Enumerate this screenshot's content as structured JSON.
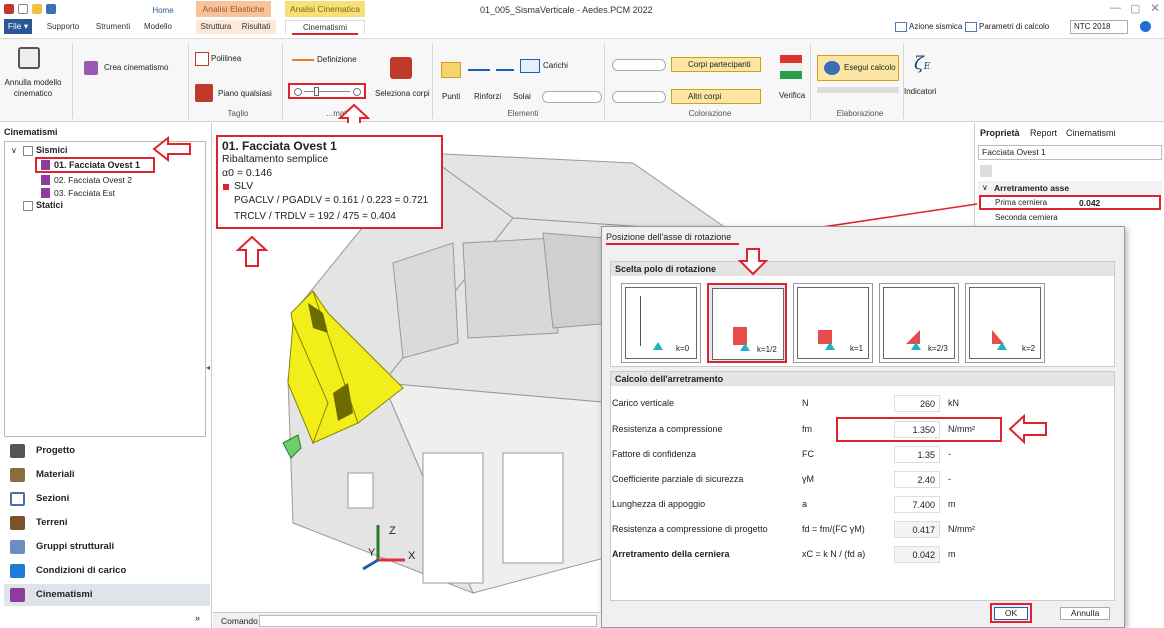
{
  "app": {
    "title": "01_005_SismaVerticale - Aedes.PCM 2022"
  },
  "menu": {
    "file": "File ▾",
    "items": [
      "Supporto",
      "Strumenti",
      "Modello",
      "Struttura",
      "Risultati"
    ],
    "home": "Home"
  },
  "context_tabs": {
    "elastiche": "Analisi Elastiche",
    "cinematica": "Analisi Cinematica",
    "cinematismi": "Cinematismi"
  },
  "top_right": {
    "azione": "Azione sismica",
    "parametri": "Parametri di calcolo",
    "ntc": "NTC 2018"
  },
  "ribbon": {
    "annulla_label": "Annulla modello cinematico",
    "crea": "Crea cinematismo",
    "polilinea": "Polilinea",
    "piano": "Piano qualsiasi",
    "definizione": "Definizione",
    "seleziona": "Seleziona corpi",
    "carichi": "Carichi",
    "punti": "Punti",
    "rinforzi": "Rinforzi",
    "solai": "Solai",
    "corpi_partecipanti": "Corpi partecipanti",
    "altri_corpi": "Altri corpi",
    "verifica": "Verifica",
    "esegui": "Esegui calcolo",
    "indicatori": "Indicatori",
    "groups": {
      "taglio": "Taglio",
      "cinematismo": "...matismo",
      "elementi": "Elementi",
      "colorazione": "Colorazione",
      "elaborazione": "Elaborazione"
    }
  },
  "left_panel": {
    "title": "Cinematismi",
    "sismici": "Sismici",
    "items": [
      "01. Facciata Ovest 1",
      "02. Facciata Ovest 2",
      "03. Facciata Est"
    ],
    "statici": "Statici"
  },
  "nav": [
    "Progetto",
    "Materiali",
    "Sezioni",
    "Terreni",
    "Gruppi strutturali",
    "Condizioni di carico",
    "Cinematismi"
  ],
  "info": {
    "title": "01. Facciata Ovest 1",
    "type": "Ribaltamento semplice",
    "alpha": "α0 = 0.146",
    "slv": "SLV",
    "pga": "PGACLV / PGADLV = 0.161 / 0.223 = 0.721",
    "tr": "TRCLV / TRDLV = 192 / 475 = 0.404"
  },
  "props": {
    "tabs": [
      "Proprietà",
      "Report",
      "Cinematismi"
    ],
    "selected": "Facciata Ovest 1",
    "section": "Arretramento asse",
    "prima": "Prima cerniera",
    "prima_val": "0.042",
    "seconda": "Seconda cerniera"
  },
  "dialog": {
    "title": "Posizione dell'asse di rotazione",
    "section1": "Scelta polo di rotazione",
    "k_options": [
      "k=0",
      "k=1/2",
      "k=1",
      "k=2/3",
      "k=2"
    ],
    "section2": "Calcolo dell'arretramento",
    "rows": [
      {
        "label": "Carico verticale",
        "sym": "N",
        "value": "260",
        "unit": "kN"
      },
      {
        "label": "Resistenza a compressione",
        "sym": "fm",
        "value": "1.350",
        "unit": "N/mm²"
      },
      {
        "label": "Fattore di confidenza",
        "sym": "FC",
        "value": "1.35",
        "unit": "-"
      },
      {
        "label": "Coefficiente parziale di sicurezza",
        "sym": "γM",
        "value": "2.40",
        "unit": "-"
      },
      {
        "label": "Lunghezza di appoggio",
        "sym": "a",
        "value": "7.400",
        "unit": "m"
      },
      {
        "label": "Resistenza a compressione di progetto",
        "sym": "fd = fm/(FC γM)",
        "value": "0.417",
        "unit": "N/mm²"
      },
      {
        "label": "Arretramento della cerniera",
        "sym": "xC = k N / (fd a)",
        "value": "0.042",
        "unit": "m"
      }
    ],
    "ok": "OK",
    "annulla": "Annulla"
  },
  "command": {
    "label": "Comando"
  },
  "axes": {
    "z": "Z",
    "x": "X",
    "y": "Y"
  },
  "colors": {
    "accent_red": "#e0222c",
    "file_blue": "#2b5797",
    "facade_yellow": "#f2ee1a"
  }
}
